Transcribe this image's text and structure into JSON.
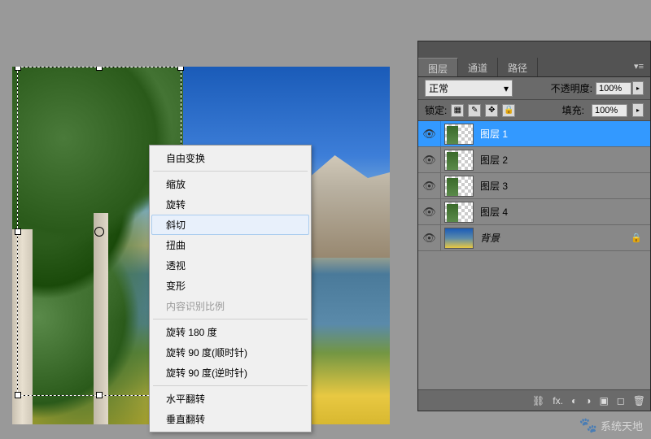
{
  "tabs": {
    "layers": "图层",
    "channels": "通道",
    "paths": "路径"
  },
  "blend_mode": "正常",
  "opacity": {
    "label": "不透明度:",
    "value": "100%"
  },
  "lock": {
    "label": "锁定:"
  },
  "fill": {
    "label": "填充:",
    "value": "100%"
  },
  "layers": [
    {
      "name": "图层 1",
      "selected": true,
      "trans": true
    },
    {
      "name": "图层 2",
      "selected": false,
      "trans": true
    },
    {
      "name": "图层 3",
      "selected": false,
      "trans": true
    },
    {
      "name": "图层 4",
      "selected": false,
      "trans": true
    },
    {
      "name": "背景",
      "selected": false,
      "bg": true,
      "locked": true
    }
  ],
  "context_menu": {
    "free_transform": "自由变换",
    "scale": "缩放",
    "rotate": "旋转",
    "skew": "斜切",
    "distort": "扭曲",
    "perspective": "透视",
    "warp": "变形",
    "content_aware": "内容识别比例",
    "rotate180": "旋转 180 度",
    "rotate90cw": "旋转 90 度(顺时针)",
    "rotate90ccw": "旋转 90 度(逆时针)",
    "flip_h": "水平翻转",
    "flip_v": "垂直翻转"
  },
  "icons": {
    "eye": "👁",
    "lock": "🔒",
    "link": "⛓",
    "fx": "fx.",
    "mask": "◐",
    "adjust": "◑",
    "folder": "▣",
    "new": "◻",
    "trash": "🗑"
  },
  "watermark": "系统天地"
}
